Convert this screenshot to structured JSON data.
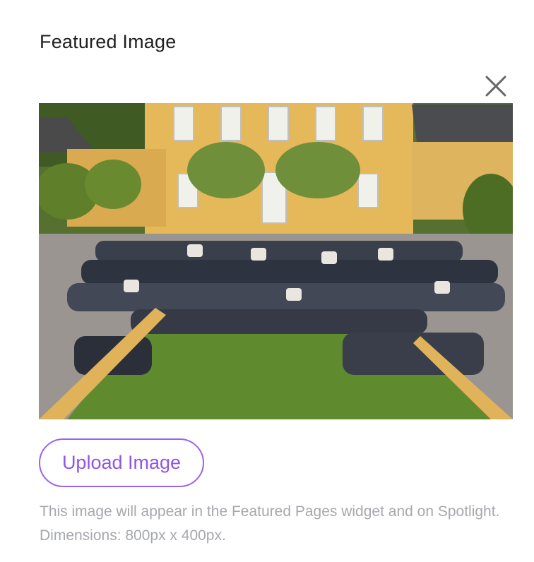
{
  "panel": {
    "title": "Featured Image",
    "close_icon": "close-icon"
  },
  "image": {
    "alt": "Group photo of staff on a lawn in front of a yellow house"
  },
  "upload": {
    "label": "Upload Image"
  },
  "help": {
    "text": "This image will appear in the Featured Pages widget and on Spotlight. Dimensions: 800px x 400px."
  },
  "colors": {
    "accent": "#9a63f0",
    "help_text": "#a6a8ad"
  }
}
